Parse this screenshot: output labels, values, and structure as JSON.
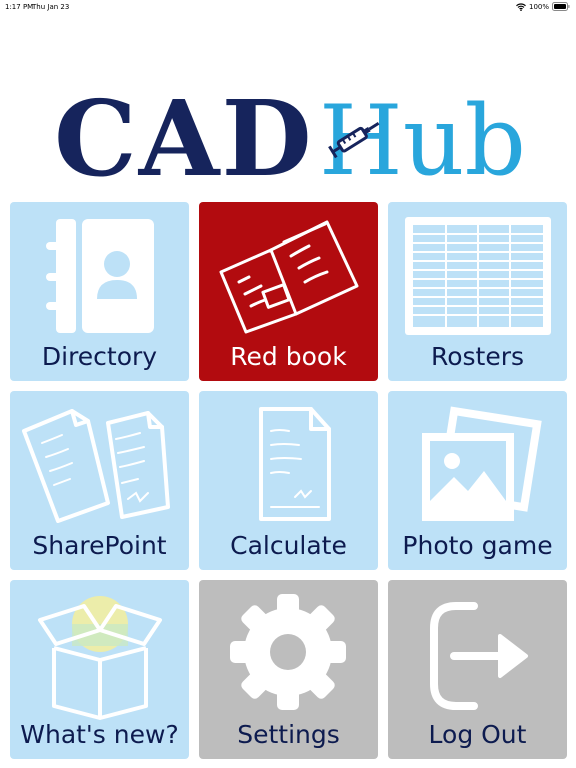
{
  "status_bar": {
    "time": "1:17 PM",
    "date": "Thu Jan 23",
    "battery": "100%"
  },
  "logo": {
    "cad": "CAD",
    "hub": "Hub",
    "colors": {
      "cad": "#16245c",
      "hub": "#29a6dc"
    }
  },
  "tiles": [
    {
      "label": "Directory",
      "icon": "contact-book-icon",
      "color": "#bde1f7"
    },
    {
      "label": "Red book",
      "icon": "open-book-icon",
      "color": "#b20b0f"
    },
    {
      "label": "Rosters",
      "icon": "spreadsheet-icon",
      "color": "#bde1f7"
    },
    {
      "label": "SharePoint",
      "icon": "documents-icon",
      "color": "#bde1f7"
    },
    {
      "label": "Calculate",
      "icon": "document-icon",
      "color": "#bde1f7"
    },
    {
      "label": "Photo game",
      "icon": "photos-icon",
      "color": "#bde1f7"
    },
    {
      "label": "What's new?",
      "icon": "open-box-icon",
      "color": "#bde1f7"
    },
    {
      "label": "Settings",
      "icon": "gear-icon",
      "color": "#bdbdbd"
    },
    {
      "label": "Log Out",
      "icon": "logout-icon",
      "color": "#bdbdbd"
    }
  ]
}
